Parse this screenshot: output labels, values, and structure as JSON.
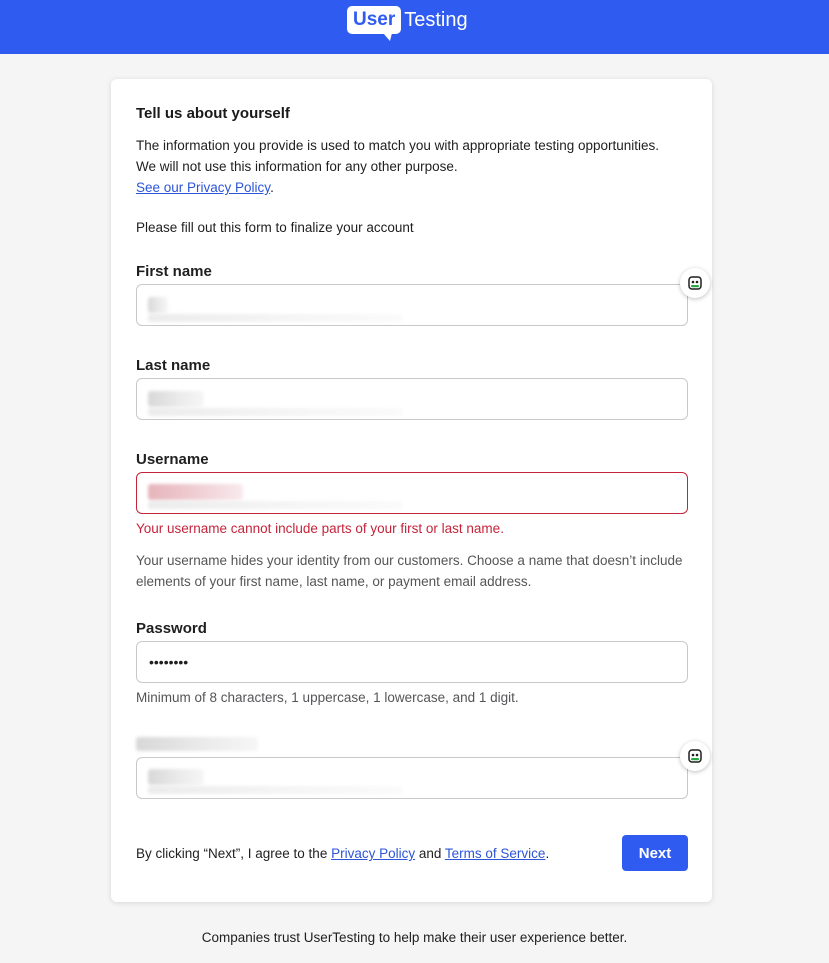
{
  "header": {
    "logo_user": "User",
    "logo_testing": "Testing"
  },
  "form": {
    "heading": "Tell us about yourself",
    "info_line1": "The information you provide is used to match you with appropriate testing opportunities.",
    "info_line2": "We will not use this information for any other purpose.",
    "privacy_link": "See our Privacy Policy",
    "privacy_suffix": ".",
    "fill_out": "Please fill out this form to finalize your account",
    "first_name": {
      "label": "First name",
      "value": ""
    },
    "last_name": {
      "label": "Last name",
      "value": ""
    },
    "username": {
      "label": "Username",
      "value": "",
      "error": "Your username cannot include parts of your first or last name.",
      "help": "Your username hides your identity from our customers. Choose a name that doesn’t include elements of your first name, last name, or payment email address."
    },
    "password": {
      "label": "Password",
      "value": "••••••••",
      "help": "Minimum of 8 characters, 1 uppercase, 1 lowercase, and 1 digit."
    },
    "zip": {
      "label": "",
      "value": ""
    },
    "agree_prefix": "By clicking “Next”, I agree to the ",
    "agree_privacy": "Privacy Policy",
    "agree_and": " and ",
    "agree_terms": "Terms of Service",
    "agree_suffix": ".",
    "next_button": "Next"
  },
  "footer": {
    "text": "Companies trust UserTesting to help make their user experience better."
  },
  "colors": {
    "brand": "#2f5bf0",
    "error": "#c5243a",
    "link": "#2d55d8"
  },
  "icons": [
    "assistant-bot-icon"
  ]
}
